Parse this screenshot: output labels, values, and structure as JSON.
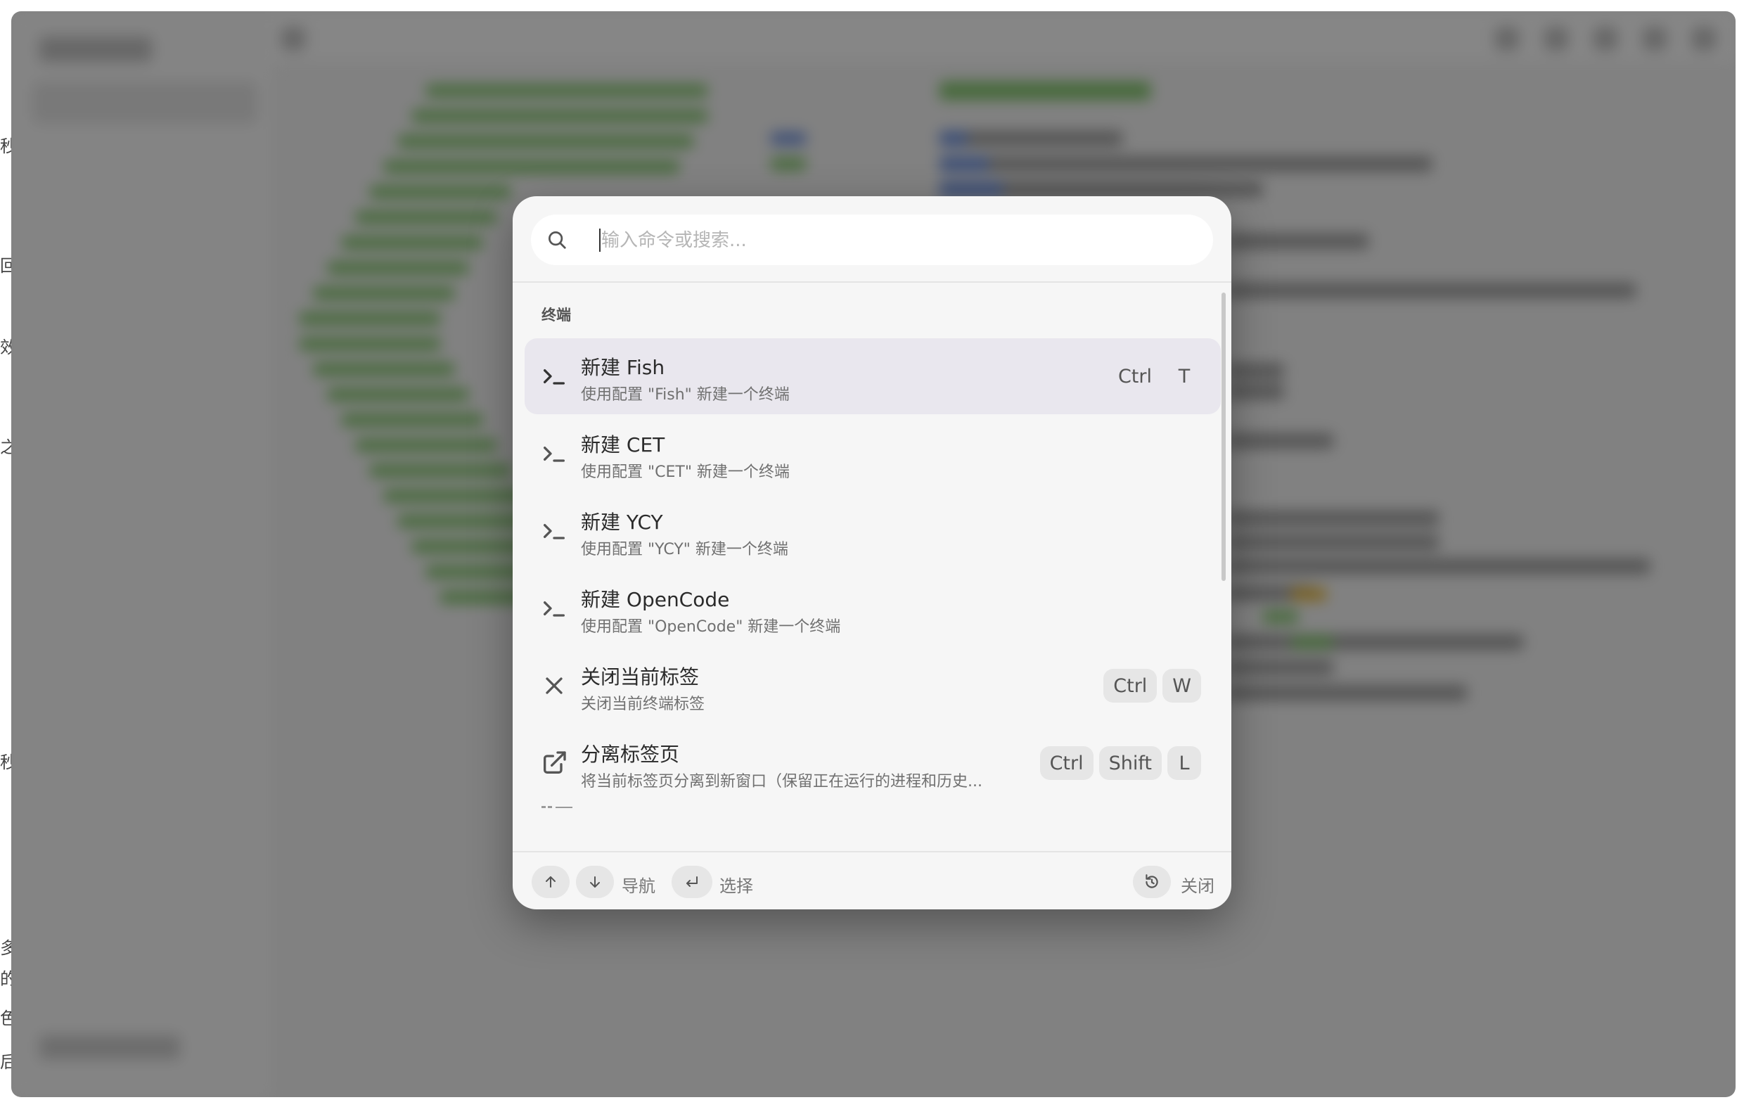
{
  "palette": {
    "search_placeholder": "输入命令或搜索...",
    "section_label": "终端",
    "items": [
      {
        "title": "新建 Fish",
        "desc": "使用配置 \"Fish\" 新建一个终端",
        "icon": "terminal-prompt-icon",
        "keys": [
          "Ctrl",
          "T"
        ],
        "selected": true
      },
      {
        "title": "新建 CET",
        "desc": "使用配置 \"CET\" 新建一个终端",
        "icon": "terminal-prompt-icon",
        "keys": []
      },
      {
        "title": "新建 YCY",
        "desc": "使用配置 \"YCY\" 新建一个终端",
        "icon": "terminal-prompt-icon",
        "keys": []
      },
      {
        "title": "新建 OpenCode",
        "desc": "使用配置 \"OpenCode\" 新建一个终端",
        "icon": "terminal-prompt-icon",
        "keys": []
      },
      {
        "title": "关闭当前标签",
        "desc": "关闭当前终端标签",
        "icon": "close-icon",
        "keys": [
          "Ctrl",
          "W"
        ]
      },
      {
        "title": "分离标签页",
        "desc": "将当前标签页分离到新窗口（保留正在运行的进程和历史...",
        "icon": "external-link-icon",
        "keys": [
          "Ctrl",
          "Shift",
          "L"
        ]
      }
    ],
    "footer": {
      "up_icon": "arrow-up-icon",
      "down_icon": "arrow-down-icon",
      "navigate_label": "导航",
      "enter_icon": "enter-icon",
      "select_label": "选择",
      "escape_icon": "escape-icon",
      "close_label": "关闭"
    }
  },
  "background": {
    "edge_fragments": [
      "秒",
      "回",
      "效",
      "之",
      "秒",
      "多",
      "的",
      "色",
      "后"
    ]
  },
  "colors": {
    "palette_bg": "#f6f6f6",
    "selected_row": "#e9e7ee",
    "overlay": "rgba(0,0,0,0.45)"
  }
}
